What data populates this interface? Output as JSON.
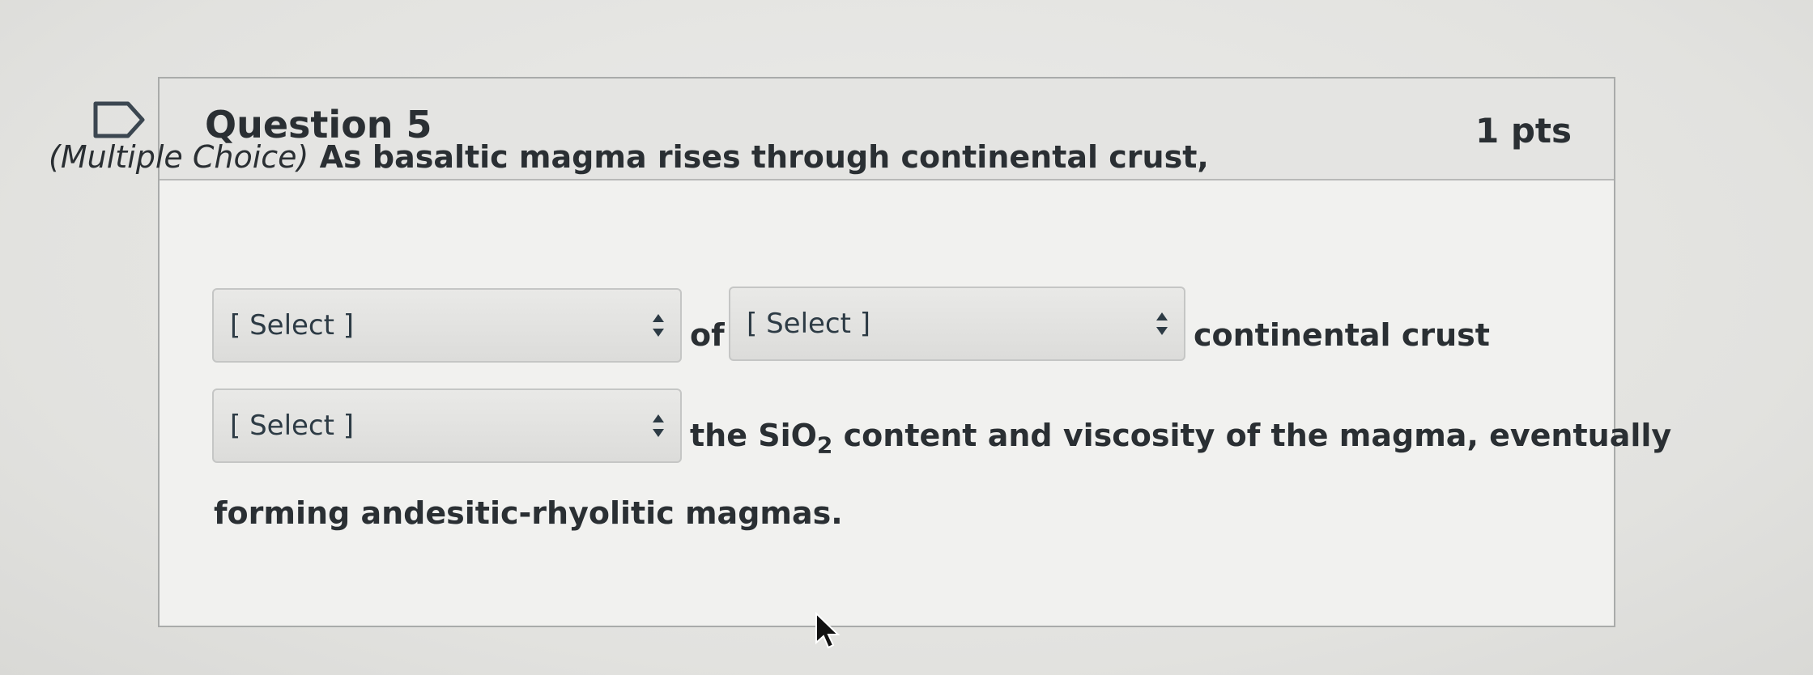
{
  "question": {
    "title": "Question 5",
    "points": "1 pts",
    "prompt_prefix": "(Multiple Choice)",
    "prompt_text": " As basaltic magma rises through continental crust,",
    "dropdowns": [
      {
        "value": "[ Select ]"
      },
      {
        "value": "[ Select ]"
      },
      {
        "value": "[ Select ]"
      }
    ],
    "connector_of": "of",
    "text_continental_crust": "continental crust",
    "text_sio2_prefix": "the SiO",
    "text_sio2_subscript": "2",
    "text_sio2_suffix": " content and viscosity of the magma, eventually",
    "text_final": "forming andesitic-rhyolitic magmas."
  },
  "icons": {
    "flag": "flag-icon",
    "dropdown_arrows": "updown-chevron-icon",
    "cursor": "mouse-pointer-icon"
  }
}
